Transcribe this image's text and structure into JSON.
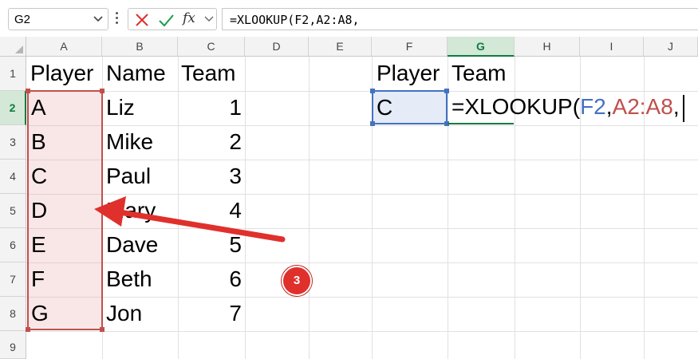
{
  "formula_bar": {
    "name_box": "G2",
    "fx_label": "fx",
    "formula": "=XLOOKUP(F2,A2:A8,"
  },
  "columns": [
    "A",
    "B",
    "C",
    "D",
    "E",
    "F",
    "G",
    "H",
    "I",
    "J"
  ],
  "rows": [
    "1",
    "2",
    "3",
    "4",
    "5",
    "6",
    "7",
    "8",
    "9"
  ],
  "table": {
    "headers": {
      "A": "Player",
      "B": "Name",
      "C": "Team"
    },
    "players": [
      "A",
      "B",
      "C",
      "D",
      "E",
      "F",
      "G"
    ],
    "names": [
      "Liz",
      "Mike",
      "Paul",
      "Mary",
      "Dave",
      "Beth",
      "Jon"
    ],
    "teams": [
      "1",
      "2",
      "3",
      "4",
      "5",
      "6",
      "7"
    ]
  },
  "lookup": {
    "player_header": "Player",
    "team_header": "Team",
    "player_value": "C",
    "formula_parts": {
      "prefix": "=XLOOKUP(",
      "ref1": "F2",
      "sep1": ",",
      "ref2": "A2:A8",
      "sep2": ","
    }
  },
  "annotation": {
    "step": "3"
  },
  "colors": {
    "accent_green": "#107c41",
    "ref_blue": "#4472c4",
    "ref_red": "#c0504d",
    "callout_red": "#e0302c"
  }
}
